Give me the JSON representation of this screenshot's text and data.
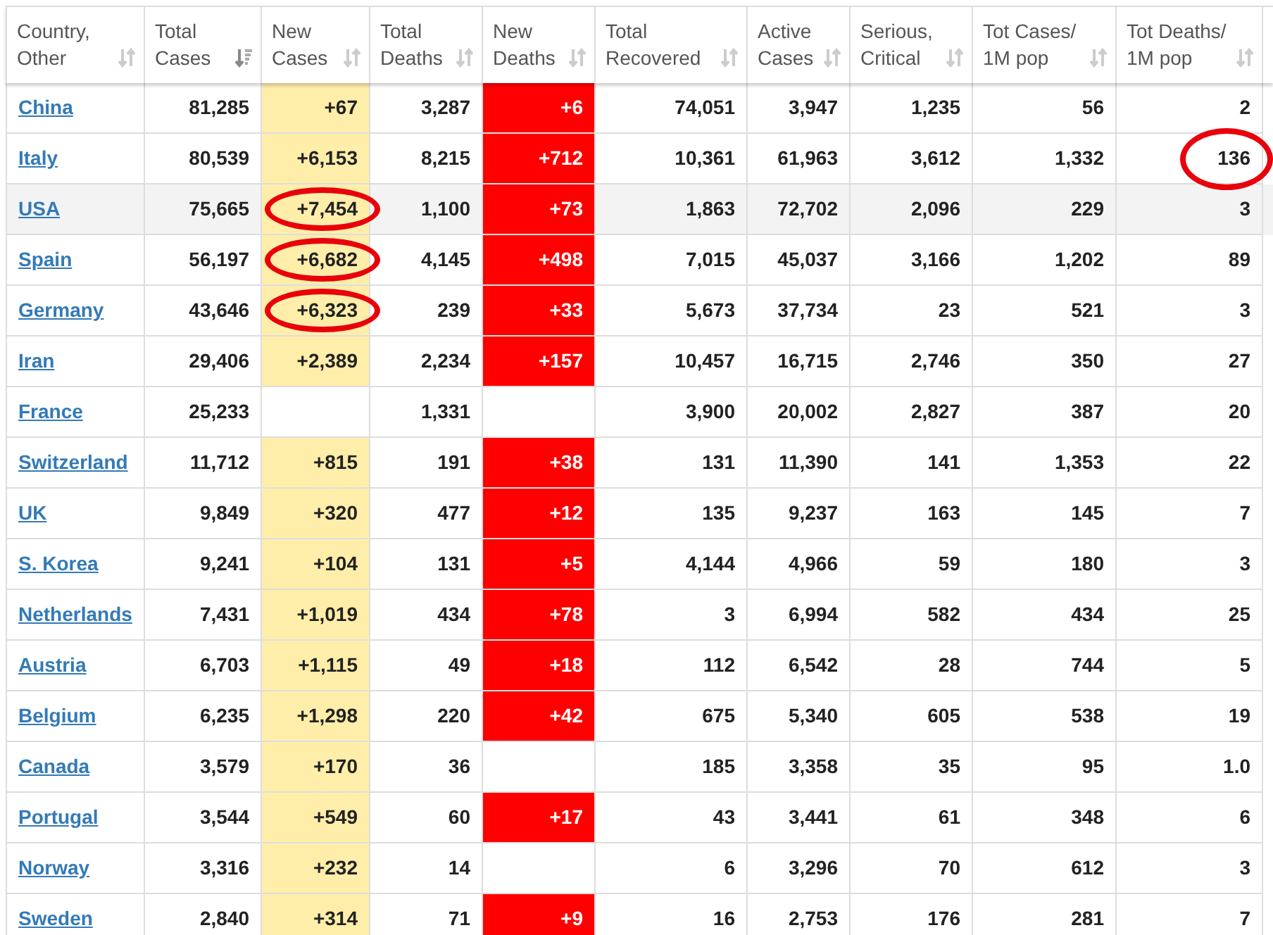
{
  "table": {
    "columns": [
      {
        "kind": "link",
        "label_lines": [
          "Country,",
          "Other"
        ],
        "sorted": false
      },
      {
        "kind": "plain",
        "label_lines": [
          "Total",
          "Cases"
        ],
        "sorted": true
      },
      {
        "kind": "gain",
        "label_lines": [
          "New",
          "Cases"
        ],
        "sorted": false
      },
      {
        "kind": "plain",
        "label_lines": [
          "Total",
          "Deaths"
        ],
        "sorted": false
      },
      {
        "kind": "alert",
        "label_lines": [
          "New",
          "Deaths"
        ],
        "sorted": false
      },
      {
        "kind": "plain",
        "label_lines": [
          "Total",
          "Recovered"
        ],
        "sorted": false
      },
      {
        "kind": "plain",
        "label_lines": [
          "Active",
          "Cases"
        ],
        "sorted": false
      },
      {
        "kind": "plain",
        "label_lines": [
          "Serious,",
          "Critical"
        ],
        "sorted": false
      },
      {
        "kind": "plain",
        "label_lines": [
          "Tot Cases/",
          "1M pop"
        ],
        "sorted": false
      },
      {
        "kind": "plain",
        "label_lines": [
          "Tot Deaths/",
          "1M pop"
        ],
        "sorted": false
      }
    ],
    "rows": [
      {
        "highlighted": false,
        "cells": [
          {
            "text": "China",
            "circled": false
          },
          {
            "text": "81,285",
            "circled": false
          },
          {
            "text": "+67",
            "circled": false
          },
          {
            "text": "3,287",
            "circled": false
          },
          {
            "text": "+6",
            "circled": false
          },
          {
            "text": "74,051",
            "circled": false
          },
          {
            "text": "3,947",
            "circled": false
          },
          {
            "text": "1,235",
            "circled": false
          },
          {
            "text": "56",
            "circled": false
          },
          {
            "text": "2",
            "circled": false
          }
        ]
      },
      {
        "highlighted": false,
        "cells": [
          {
            "text": "Italy",
            "circled": false
          },
          {
            "text": "80,539",
            "circled": false
          },
          {
            "text": "+6,153",
            "circled": false
          },
          {
            "text": "8,215",
            "circled": false
          },
          {
            "text": "+712",
            "circled": false
          },
          {
            "text": "10,361",
            "circled": false
          },
          {
            "text": "61,963",
            "circled": false
          },
          {
            "text": "3,612",
            "circled": false
          },
          {
            "text": "1,332",
            "circled": false
          },
          {
            "text": "136",
            "circled": true
          }
        ]
      },
      {
        "highlighted": true,
        "cells": [
          {
            "text": "USA",
            "circled": false
          },
          {
            "text": "75,665",
            "circled": false
          },
          {
            "text": "+7,454",
            "circled": true
          },
          {
            "text": "1,100",
            "circled": false
          },
          {
            "text": "+73",
            "circled": false
          },
          {
            "text": "1,863",
            "circled": false
          },
          {
            "text": "72,702",
            "circled": false
          },
          {
            "text": "2,096",
            "circled": false
          },
          {
            "text": "229",
            "circled": false
          },
          {
            "text": "3",
            "circled": false
          }
        ]
      },
      {
        "highlighted": false,
        "cells": [
          {
            "text": "Spain",
            "circled": false
          },
          {
            "text": "56,197",
            "circled": false
          },
          {
            "text": "+6,682",
            "circled": true
          },
          {
            "text": "4,145",
            "circled": false
          },
          {
            "text": "+498",
            "circled": false
          },
          {
            "text": "7,015",
            "circled": false
          },
          {
            "text": "45,037",
            "circled": false
          },
          {
            "text": "3,166",
            "circled": false
          },
          {
            "text": "1,202",
            "circled": false
          },
          {
            "text": "89",
            "circled": false
          }
        ]
      },
      {
        "highlighted": false,
        "cells": [
          {
            "text": "Germany",
            "circled": false
          },
          {
            "text": "43,646",
            "circled": false
          },
          {
            "text": "+6,323",
            "circled": true
          },
          {
            "text": "239",
            "circled": false
          },
          {
            "text": "+33",
            "circled": false
          },
          {
            "text": "5,673",
            "circled": false
          },
          {
            "text": "37,734",
            "circled": false
          },
          {
            "text": "23",
            "circled": false
          },
          {
            "text": "521",
            "circled": false
          },
          {
            "text": "3",
            "circled": false
          }
        ]
      },
      {
        "highlighted": false,
        "cells": [
          {
            "text": "Iran",
            "circled": false
          },
          {
            "text": "29,406",
            "circled": false
          },
          {
            "text": "+2,389",
            "circled": false
          },
          {
            "text": "2,234",
            "circled": false
          },
          {
            "text": "+157",
            "circled": false
          },
          {
            "text": "10,457",
            "circled": false
          },
          {
            "text": "16,715",
            "circled": false
          },
          {
            "text": "2,746",
            "circled": false
          },
          {
            "text": "350",
            "circled": false
          },
          {
            "text": "27",
            "circled": false
          }
        ]
      },
      {
        "highlighted": false,
        "cells": [
          {
            "text": "France",
            "circled": false
          },
          {
            "text": "25,233",
            "circled": false
          },
          {
            "circled": false
          },
          {
            "text": "1,331",
            "circled": false
          },
          {
            "circled": false
          },
          {
            "text": "3,900",
            "circled": false
          },
          {
            "text": "20,002",
            "circled": false
          },
          {
            "text": "2,827",
            "circled": false
          },
          {
            "text": "387",
            "circled": false
          },
          {
            "text": "20",
            "circled": false
          }
        ]
      },
      {
        "highlighted": false,
        "cells": [
          {
            "text": "Switzerland",
            "circled": false
          },
          {
            "text": "11,712",
            "circled": false
          },
          {
            "text": "+815",
            "circled": false
          },
          {
            "text": "191",
            "circled": false
          },
          {
            "text": "+38",
            "circled": false
          },
          {
            "text": "131",
            "circled": false
          },
          {
            "text": "11,390",
            "circled": false
          },
          {
            "text": "141",
            "circled": false
          },
          {
            "text": "1,353",
            "circled": false
          },
          {
            "text": "22",
            "circled": false
          }
        ]
      },
      {
        "highlighted": false,
        "cells": [
          {
            "text": "UK",
            "circled": false
          },
          {
            "text": "9,849",
            "circled": false
          },
          {
            "text": "+320",
            "circled": false
          },
          {
            "text": "477",
            "circled": false
          },
          {
            "text": "+12",
            "circled": false
          },
          {
            "text": "135",
            "circled": false
          },
          {
            "text": "9,237",
            "circled": false
          },
          {
            "text": "163",
            "circled": false
          },
          {
            "text": "145",
            "circled": false
          },
          {
            "text": "7",
            "circled": false
          }
        ]
      },
      {
        "highlighted": false,
        "cells": [
          {
            "text": "S. Korea",
            "circled": false
          },
          {
            "text": "9,241",
            "circled": false
          },
          {
            "text": "+104",
            "circled": false
          },
          {
            "text": "131",
            "circled": false
          },
          {
            "text": "+5",
            "circled": false
          },
          {
            "text": "4,144",
            "circled": false
          },
          {
            "text": "4,966",
            "circled": false
          },
          {
            "text": "59",
            "circled": false
          },
          {
            "text": "180",
            "circled": false
          },
          {
            "text": "3",
            "circled": false
          }
        ]
      },
      {
        "highlighted": false,
        "cells": [
          {
            "text": "Netherlands",
            "circled": false
          },
          {
            "text": "7,431",
            "circled": false
          },
          {
            "text": "+1,019",
            "circled": false
          },
          {
            "text": "434",
            "circled": false
          },
          {
            "text": "+78",
            "circled": false
          },
          {
            "text": "3",
            "circled": false
          },
          {
            "text": "6,994",
            "circled": false
          },
          {
            "text": "582",
            "circled": false
          },
          {
            "text": "434",
            "circled": false
          },
          {
            "text": "25",
            "circled": false
          }
        ]
      },
      {
        "highlighted": false,
        "cells": [
          {
            "text": "Austria",
            "circled": false
          },
          {
            "text": "6,703",
            "circled": false
          },
          {
            "text": "+1,115",
            "circled": false
          },
          {
            "text": "49",
            "circled": false
          },
          {
            "text": "+18",
            "circled": false
          },
          {
            "text": "112",
            "circled": false
          },
          {
            "text": "6,542",
            "circled": false
          },
          {
            "text": "28",
            "circled": false
          },
          {
            "text": "744",
            "circled": false
          },
          {
            "text": "5",
            "circled": false
          }
        ]
      },
      {
        "highlighted": false,
        "cells": [
          {
            "text": "Belgium",
            "circled": false
          },
          {
            "text": "6,235",
            "circled": false
          },
          {
            "text": "+1,298",
            "circled": false
          },
          {
            "text": "220",
            "circled": false
          },
          {
            "text": "+42",
            "circled": false
          },
          {
            "text": "675",
            "circled": false
          },
          {
            "text": "5,340",
            "circled": false
          },
          {
            "text": "605",
            "circled": false
          },
          {
            "text": "538",
            "circled": false
          },
          {
            "text": "19",
            "circled": false
          }
        ]
      },
      {
        "highlighted": false,
        "cells": [
          {
            "text": "Canada",
            "circled": false
          },
          {
            "text": "3,579",
            "circled": false
          },
          {
            "text": "+170",
            "circled": false
          },
          {
            "text": "36",
            "circled": false
          },
          {
            "circled": false
          },
          {
            "text": "185",
            "circled": false
          },
          {
            "text": "3,358",
            "circled": false
          },
          {
            "text": "35",
            "circled": false
          },
          {
            "text": "95",
            "circled": false
          },
          {
            "text": "1.0",
            "circled": false
          }
        ]
      },
      {
        "highlighted": false,
        "cells": [
          {
            "text": "Portugal",
            "circled": false
          },
          {
            "text": "3,544",
            "circled": false
          },
          {
            "text": "+549",
            "circled": false
          },
          {
            "text": "60",
            "circled": false
          },
          {
            "text": "+17",
            "circled": false
          },
          {
            "text": "43",
            "circled": false
          },
          {
            "text": "3,441",
            "circled": false
          },
          {
            "text": "61",
            "circled": false
          },
          {
            "text": "348",
            "circled": false
          },
          {
            "text": "6",
            "circled": false
          }
        ]
      },
      {
        "highlighted": false,
        "cells": [
          {
            "text": "Norway",
            "circled": false
          },
          {
            "text": "3,316",
            "circled": false
          },
          {
            "text": "+232",
            "circled": false
          },
          {
            "text": "14",
            "circled": false
          },
          {
            "circled": false
          },
          {
            "text": "6",
            "circled": false
          },
          {
            "text": "3,296",
            "circled": false
          },
          {
            "text": "70",
            "circled": false
          },
          {
            "text": "612",
            "circled": false
          },
          {
            "text": "3",
            "circled": false
          }
        ]
      },
      {
        "highlighted": false,
        "cells": [
          {
            "text": "Sweden",
            "circled": false
          },
          {
            "text": "2,840",
            "circled": false
          },
          {
            "text": "+314",
            "circled": false
          },
          {
            "text": "71",
            "circled": false
          },
          {
            "text": "+9",
            "circled": false
          },
          {
            "text": "16",
            "circled": false
          },
          {
            "text": "2,753",
            "circled": false
          },
          {
            "text": "176",
            "circled": false
          },
          {
            "text": "281",
            "circled": false
          },
          {
            "text": "7",
            "circled": false
          }
        ]
      }
    ]
  }
}
